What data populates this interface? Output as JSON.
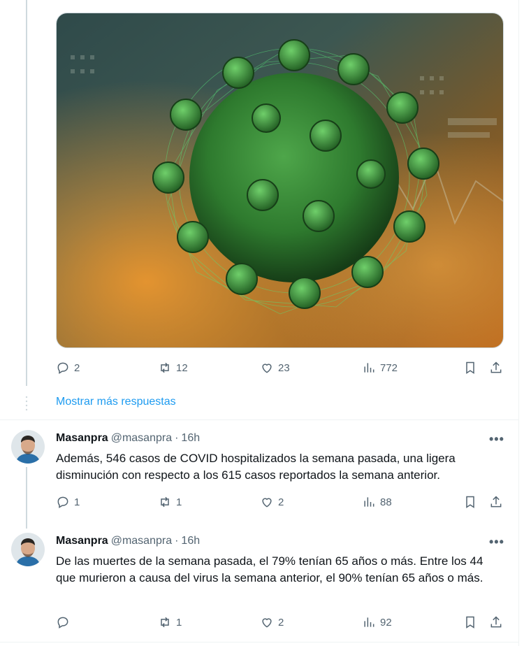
{
  "top_tweet": {
    "stats": {
      "replies": "2",
      "retweets": "12",
      "likes": "23",
      "views": "772"
    }
  },
  "show_more": "Mostrar más respuestas",
  "replies": [
    {
      "name": "Masanpra",
      "handle": "@masanpra",
      "separator": "·",
      "time": "16h",
      "text": "Además, 546 casos de COVID hospitalizados la semana pasada, una ligera disminución con respecto a los 615 casos reportados la semana anterior.",
      "stats": {
        "replies": "1",
        "retweets": "1",
        "likes": "2",
        "views": "88"
      }
    },
    {
      "name": "Masanpra",
      "handle": "@masanpra",
      "separator": "·",
      "time": "16h",
      "text": "De las muertes de la semana pasada, el 79% tenían 65 años o más. Entre los 44 que murieron a causa del virus la semana anterior, el 90% tenían 65 años o más.",
      "stats": {
        "replies": "",
        "retweets": "1",
        "likes": "2",
        "views": "92"
      }
    }
  ],
  "more_label": "•••",
  "colors": {
    "accent": "#1d9bf0",
    "muted": "#536471",
    "text": "#0f1419",
    "virus_green": "#2fbf4f"
  }
}
